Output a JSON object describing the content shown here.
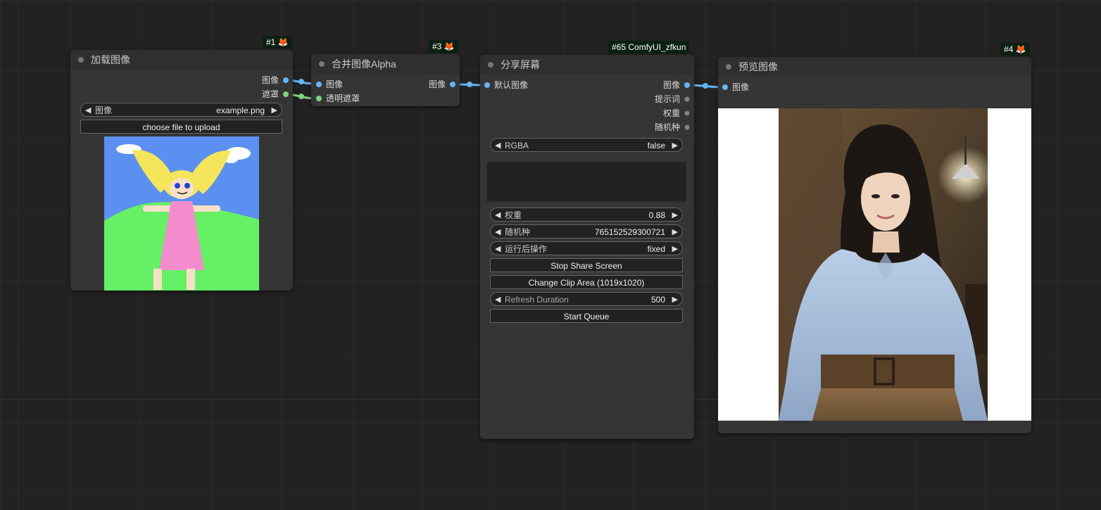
{
  "nodes": {
    "load_image": {
      "badge": "#1 🦊",
      "title": "加载图像",
      "outputs": [
        "图像",
        "遮罩"
      ],
      "image_widget": {
        "label": "图像",
        "value": "example.png"
      },
      "upload_label": "choose file to upload"
    },
    "merge_alpha": {
      "badge": "#3 🦊",
      "title": "合并图像Alpha",
      "inputs": [
        "图像",
        "透明遮罩"
      ],
      "output": "图像"
    },
    "share_screen": {
      "badge": "#65 ComfyUI_zfkun",
      "title": "分享屏幕",
      "input": "默认图像",
      "outputs": [
        "图像",
        "提示词",
        "权重",
        "随机种"
      ],
      "rgba_widget": {
        "label": "RGBA",
        "value": "false"
      },
      "weight_widget": {
        "label": "权重",
        "value": "0.88"
      },
      "seed_widget": {
        "label": "随机种",
        "value": "765152529300721"
      },
      "after_run_widget": {
        "label": "运行后操作",
        "value": "fixed"
      },
      "stop_share_label": "Stop Share Screen",
      "change_clip_label": "Change Clip Area (1019x1020)",
      "refresh_widget": {
        "label": "Refresh Duration",
        "value": "500"
      },
      "start_queue_label": "Start Queue"
    },
    "preview_image": {
      "badge": "#4 🦊",
      "title": "预览图像",
      "input": "图像"
    }
  },
  "colors": {
    "image_slot": "#64b5f6",
    "mask_slot": "#7fd27f",
    "badge_bg": "#0c1f13",
    "node_bg": "#353535",
    "canvas_bg": "#222222"
  },
  "icons": {
    "arrow_left": "◀",
    "arrow_right": "▶"
  }
}
